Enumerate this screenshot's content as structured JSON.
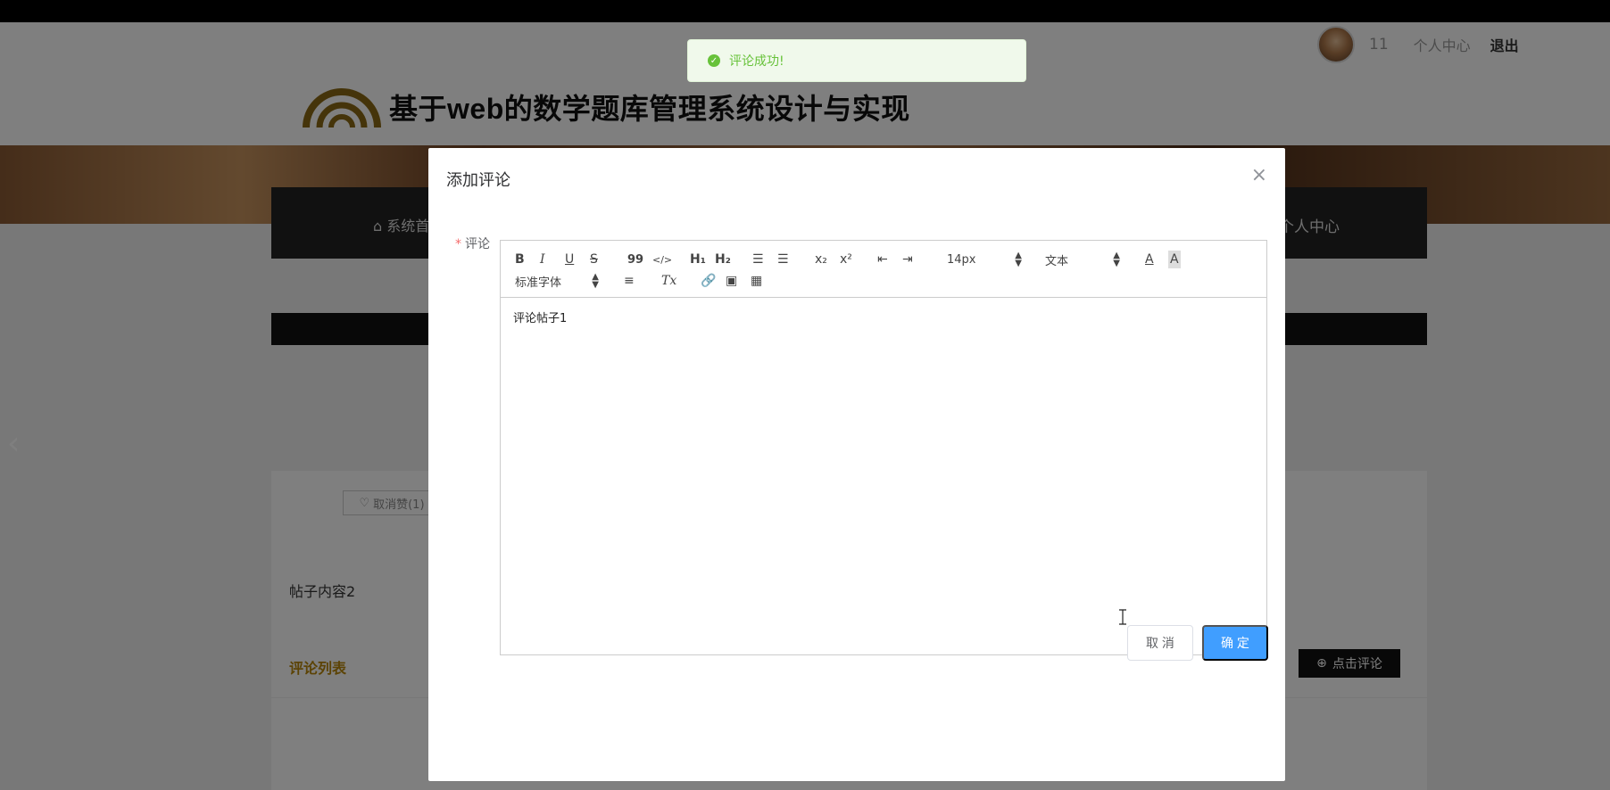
{
  "topbar": {
    "username": "11",
    "user_center": "个人中心",
    "logout": "退出"
  },
  "header": {
    "site_title": "基于web的数学题库管理系统设计与实现"
  },
  "nav": {
    "home": "系统首",
    "user_center": "个人中心"
  },
  "post": {
    "unlike_label": "取消赞(1)",
    "content": "帖子内容2",
    "comment_list_title": "评论列表",
    "click_comment": "点击评论"
  },
  "dialog": {
    "title": "添加评论",
    "close": "×",
    "field_label": "评论",
    "required_mark": "*",
    "editor_text": "评论帖子1",
    "toolbar": {
      "bold": "B",
      "italic": "I",
      "underline": "U",
      "strike": "S",
      "blockquote": "99",
      "code": "</>",
      "h1": "H₁",
      "h2": "H₂",
      "subscript": "x₂",
      "superscript": "x²",
      "size": "14px",
      "header": "文本",
      "font": "标准字体",
      "clean": "Tx"
    },
    "cancel_label": "取 消",
    "ok_label": "确 定"
  },
  "toast": {
    "message": "评论成功!"
  },
  "colors": {
    "primary": "#409eff",
    "success": "#67c23a",
    "danger": "#f56c6c",
    "accent_gold": "#b8860b"
  }
}
